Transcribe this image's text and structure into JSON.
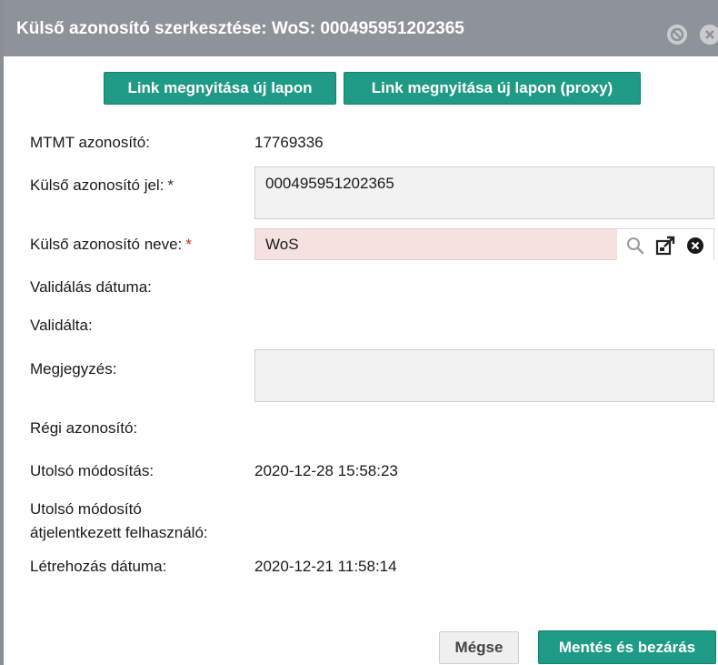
{
  "dialog": {
    "title": "Külső azonosító szerkesztése: WoS: 000495951202365"
  },
  "toolbar": {
    "open_link_label": "Link megnyitása új lapon",
    "open_link_proxy_label": "Link megnyitása új lapon (proxy)"
  },
  "form": {
    "mtmt_id": {
      "label": "MTMT azonosító:",
      "value": "17769336"
    },
    "external_id": {
      "label": "Külső azonosító jel:",
      "required_mark": "*",
      "value": "000495951202365"
    },
    "external_name": {
      "label": "Külső azonosító neve:",
      "required_mark": "*",
      "value": "WoS"
    },
    "validation_date": {
      "label": "Validálás dátuma:"
    },
    "validated_by": {
      "label": "Validálta:"
    },
    "note": {
      "label": "Megjegyzés:",
      "value": ""
    },
    "old_id": {
      "label": "Régi azonosító:"
    },
    "last_modified": {
      "label": "Utolsó módosítás:",
      "value": "2020-12-28 15:58:23"
    },
    "last_modifier": {
      "label_line1": "Utolsó módosító",
      "label_line2": "átjelentkezett felhasználó:"
    },
    "created_date": {
      "label": "Létrehozás dátuma:",
      "value": "2020-12-21 11:58:14"
    }
  },
  "footer": {
    "cancel_label": "Mégse",
    "save_close_label": "Mentés és bezárás"
  },
  "colors": {
    "titlebar": "#8e9399",
    "accent": "#1f9a85",
    "required": "#cc2a2a",
    "invalid_field_bg": "#f6e1e1"
  }
}
